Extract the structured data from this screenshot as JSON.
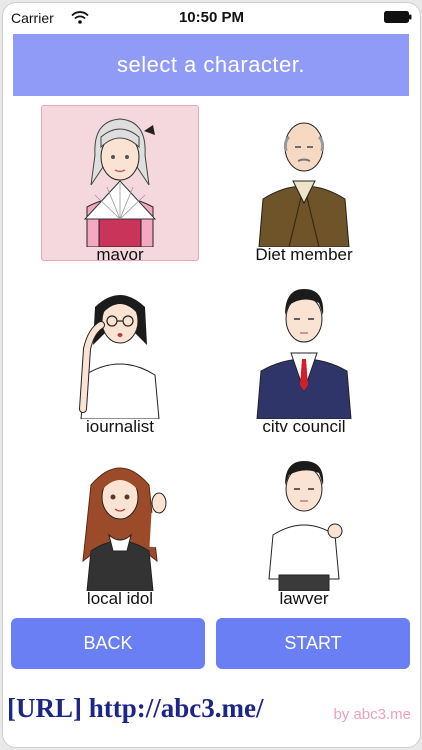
{
  "status_bar": {
    "carrier": "Carrier",
    "time": "10:50 PM",
    "wifi_icon": "wifi-icon",
    "battery_icon": "battery-icon"
  },
  "header": {
    "title": "select a character."
  },
  "characters": [
    {
      "label": "mavor",
      "selected": true
    },
    {
      "label": "Diet member",
      "selected": false
    },
    {
      "label": "iournalist",
      "selected": false
    },
    {
      "label": "citv council",
      "selected": false
    },
    {
      "label": "local idol",
      "selected": false
    },
    {
      "label": "lawver",
      "selected": false
    }
  ],
  "buttons": {
    "back": "BACK",
    "start": "START"
  },
  "footer": {
    "url": "[URL] http://abc3.me/",
    "credit": "by abc3.me"
  },
  "colors": {
    "header_bg": "#8f9bf6",
    "button_bg": "#6b7ff5",
    "selected_bg": "#f4d8dd",
    "url_text": "#1c2687",
    "credit_text": "#ef9fbd"
  }
}
